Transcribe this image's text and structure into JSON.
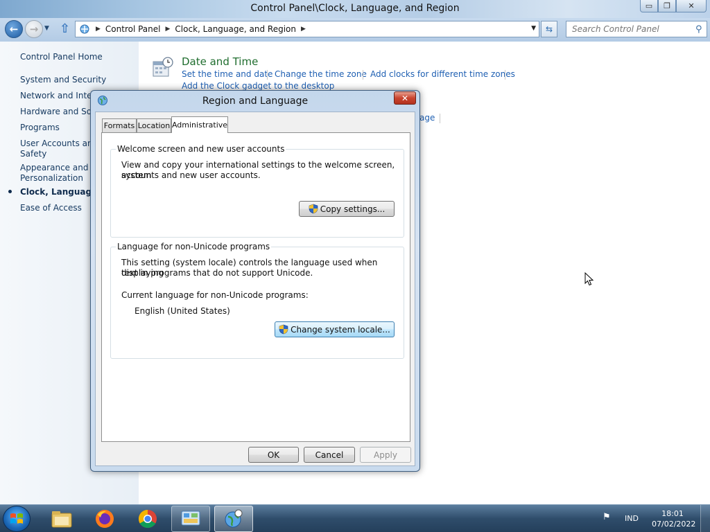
{
  "window": {
    "title": "Control Panel\\Clock, Language, and Region",
    "controls": {
      "minimize": "▭",
      "maximize": "❐",
      "close": "✕"
    }
  },
  "navbar": {
    "breadcrumbs": [
      "Control Panel",
      "Clock, Language, and Region"
    ],
    "search_placeholder": "Search Control Panel"
  },
  "leftnav": {
    "items": [
      "Control Panel Home",
      "System and Security",
      "Network and Intern",
      "Hardware and Soun",
      "Programs",
      "User Accounts and",
      "Safety",
      "Appearance and",
      "Personalization",
      "Clock, Language, a",
      "Ease of Access"
    ],
    "active_index": 9
  },
  "main": {
    "date_time": {
      "heading": "Date and Time",
      "links": [
        "Set the time and date",
        "Change the time zone",
        "Add clocks for different time zones"
      ],
      "gadget_link": "Add the Clock gadget to the desktop"
    },
    "region_link_fragment": "age"
  },
  "dialog": {
    "title": "Region and Language",
    "close_label": "✕",
    "tabs": [
      "Formats",
      "Location",
      "Administrative"
    ],
    "active_tab": "Administrative",
    "welcome_group": {
      "label": "Welcome screen and new user accounts",
      "description_line1": "View and copy your international settings to the welcome screen, system",
      "description_line2": "accounts and new user accounts.",
      "button": "Copy settings..."
    },
    "unicode_group": {
      "label": "Language for non-Unicode programs",
      "description_line1": "This setting (system locale) controls the language used when displaying",
      "description_line2": "text in programs that do not support Unicode.",
      "current_label": "Current language for non-Unicode programs:",
      "current_value": "English (United States)",
      "button": "Change system locale..."
    },
    "buttons": {
      "ok": "OK",
      "cancel": "Cancel",
      "apply": "Apply"
    }
  },
  "taskbar": {
    "tray_language": "IND",
    "time": "18:01",
    "date": "07/02/2022",
    "pinned": [
      "windows-explorer",
      "firefox",
      "chrome",
      "control-panel",
      "region-language"
    ]
  },
  "colors": {
    "link": "#1e5fb2",
    "heading_green": "#1f6d2e",
    "dialog_frame": "#c4d7ec",
    "taskbar": "#2f4d6b"
  }
}
